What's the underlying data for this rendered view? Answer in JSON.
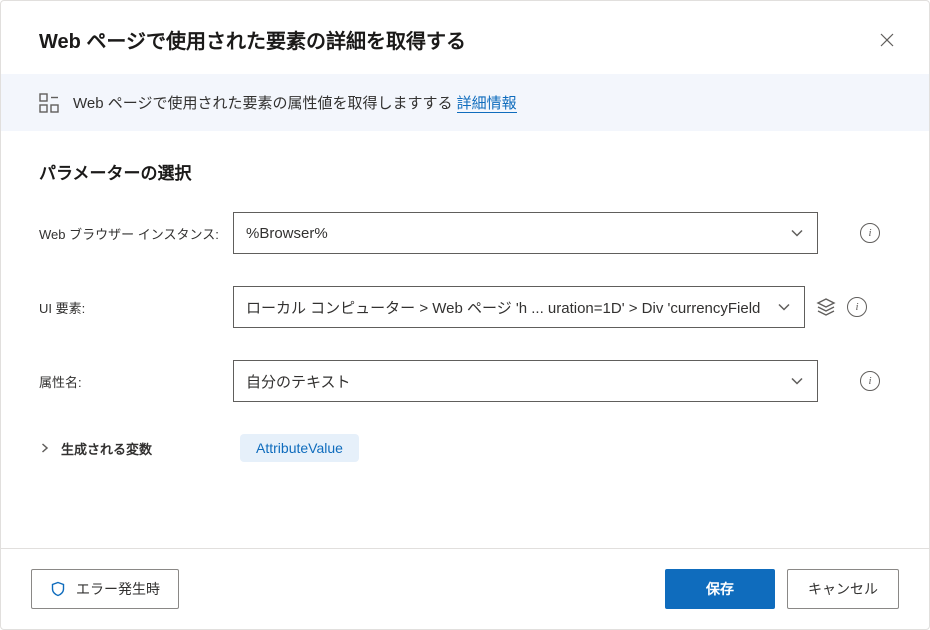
{
  "header": {
    "title": "Web ページで使用された要素の詳細を取得する"
  },
  "infoBar": {
    "text": "Web ページで使用された要素の属性値を取得しますする ",
    "linkText": "詳細情報"
  },
  "content": {
    "sectionTitle": "パラメーターの選択",
    "fields": {
      "browserInstance": {
        "label": "Web ブラウザー インスタンス:",
        "value": "%Browser%"
      },
      "uiElement": {
        "label": "UI 要素:",
        "value": "ローカル コンピューター > Web ページ 'h ... uration=1D' > Div 'currencyField"
      },
      "attributeName": {
        "label": "属性名:",
        "value": "自分のテキスト"
      }
    },
    "variables": {
      "label": "生成される変数",
      "chipText": "AttributeValue"
    }
  },
  "footer": {
    "errorButton": "エラー発生時",
    "saveButton": "保存",
    "cancelButton": "キャンセル"
  }
}
